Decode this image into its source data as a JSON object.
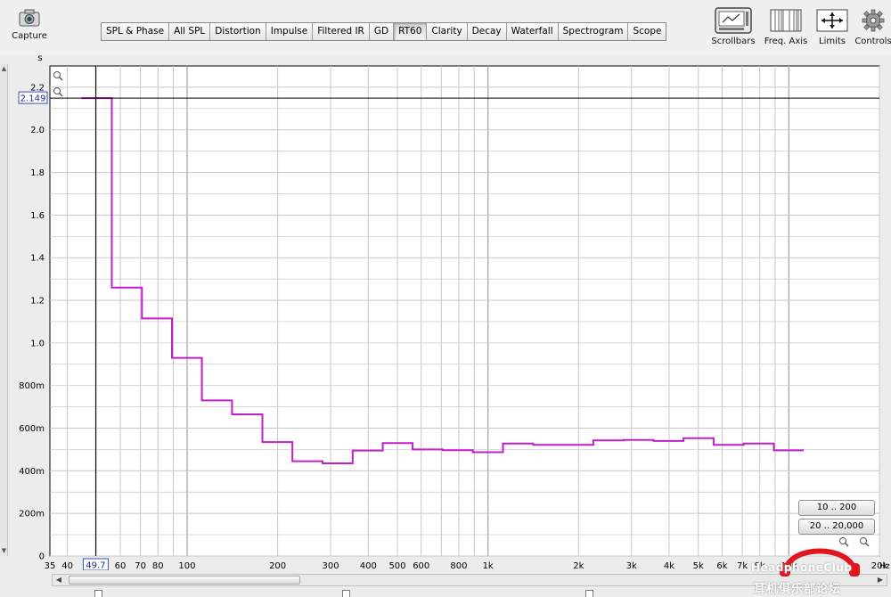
{
  "toolbar": {
    "capture_label": "Capture",
    "scrollbars_label": "Scrollbars",
    "freq_axis_label": "Freq. Axis",
    "limits_label": "Limits",
    "controls_label": "Controls"
  },
  "tabs": [
    {
      "label": "SPL & Phase",
      "active": false
    },
    {
      "label": "All SPL",
      "active": false
    },
    {
      "label": "Distortion",
      "active": false
    },
    {
      "label": "Impulse",
      "active": false
    },
    {
      "label": "Filtered IR",
      "active": false
    },
    {
      "label": "GD",
      "active": false
    },
    {
      "label": "RT60",
      "active": true
    },
    {
      "label": "Clarity",
      "active": false
    },
    {
      "label": "Decay",
      "active": false
    },
    {
      "label": "Waterfall",
      "active": false
    },
    {
      "label": "Spectrogram",
      "active": false
    },
    {
      "label": "Scope",
      "active": false
    }
  ],
  "cursor": {
    "y_value_label": "2.149",
    "x_value_label": "49.7",
    "x_value": 49.7,
    "y_value": 2.149
  },
  "range_buttons": {
    "low": "10 .. 200",
    "full": "20 .. 20,000"
  },
  "watermark": {
    "line1": "HeadphoneClub",
    "line2": "耳机俱乐部论坛"
  },
  "colors": {
    "trace": "#c020c8",
    "grid": "#c8c8c8",
    "grid_major": "#a8a8a8",
    "cursor": "#000000",
    "watermark_logo": "#e0161c"
  },
  "chart_data": {
    "type": "line",
    "title": "",
    "xlabel": "Hz",
    "ylabel": "s",
    "x_scale": "log",
    "xlim": [
      35,
      20000
    ],
    "ylim": [
      0,
      2.3
    ],
    "grid": true,
    "y_ticks": [
      {
        "value": 0,
        "label": "0"
      },
      {
        "value": 0.2,
        "label": "200m"
      },
      {
        "value": 0.4,
        "label": "400m"
      },
      {
        "value": 0.6,
        "label": "600m"
      },
      {
        "value": 0.8,
        "label": "800m"
      },
      {
        "value": 1.0,
        "label": "1.0"
      },
      {
        "value": 1.2,
        "label": "1.2"
      },
      {
        "value": 1.4,
        "label": "1.4"
      },
      {
        "value": 1.6,
        "label": "1.6"
      },
      {
        "value": 1.8,
        "label": "1.8"
      },
      {
        "value": 2.0,
        "label": "2.0"
      },
      {
        "value": 2.2,
        "label": "2.2"
      }
    ],
    "x_ticks": [
      {
        "value": 35,
        "label": "35"
      },
      {
        "value": 40,
        "label": "40"
      },
      {
        "value": 60,
        "label": "60"
      },
      {
        "value": 70,
        "label": "70"
      },
      {
        "value": 80,
        "label": "80"
      },
      {
        "value": 100,
        "label": "100"
      },
      {
        "value": 200,
        "label": "200"
      },
      {
        "value": 300,
        "label": "300"
      },
      {
        "value": 400,
        "label": "400"
      },
      {
        "value": 500,
        "label": "500"
      },
      {
        "value": 600,
        "label": "600"
      },
      {
        "value": 800,
        "label": "800"
      },
      {
        "value": 1000,
        "label": "1k"
      },
      {
        "value": 2000,
        "label": "2k"
      },
      {
        "value": 3000,
        "label": "3k"
      },
      {
        "value": 4000,
        "label": "4k"
      },
      {
        "value": 5000,
        "label": "5k"
      },
      {
        "value": 6000,
        "label": "6k"
      },
      {
        "value": 7000,
        "label": "7k"
      },
      {
        "value": 8000,
        "label": "8k"
      },
      {
        "value": 10000,
        "label": "10k"
      },
      {
        "value": 20000,
        "label": "20k"
      }
    ],
    "series": [
      {
        "bands": [
          {
            "f_lo": 44.6,
            "f_hi": 56.2,
            "rt60": 2.149
          },
          {
            "f_lo": 56.2,
            "f_hi": 70.8,
            "rt60": 1.26
          },
          {
            "f_lo": 70.8,
            "f_hi": 89.1,
            "rt60": 1.115
          },
          {
            "f_lo": 89.1,
            "f_hi": 112,
            "rt60": 0.93
          },
          {
            "f_lo": 112,
            "f_hi": 141,
            "rt60": 0.73
          },
          {
            "f_lo": 141,
            "f_hi": 178,
            "rt60": 0.665
          },
          {
            "f_lo": 178,
            "f_hi": 224,
            "rt60": 0.535
          },
          {
            "f_lo": 224,
            "f_hi": 282,
            "rt60": 0.445
          },
          {
            "f_lo": 282,
            "f_hi": 355,
            "rt60": 0.435
          },
          {
            "f_lo": 355,
            "f_hi": 447,
            "rt60": 0.495
          },
          {
            "f_lo": 447,
            "f_hi": 562,
            "rt60": 0.53
          },
          {
            "f_lo": 562,
            "f_hi": 708,
            "rt60": 0.5
          },
          {
            "f_lo": 708,
            "f_hi": 891,
            "rt60": 0.497
          },
          {
            "f_lo": 891,
            "f_hi": 1122,
            "rt60": 0.487
          },
          {
            "f_lo": 1122,
            "f_hi": 1413,
            "rt60": 0.528
          },
          {
            "f_lo": 1413,
            "f_hi": 1778,
            "rt60": 0.522
          },
          {
            "f_lo": 1778,
            "f_hi": 2239,
            "rt60": 0.522
          },
          {
            "f_lo": 2239,
            "f_hi": 2818,
            "rt60": 0.543
          },
          {
            "f_lo": 2818,
            "f_hi": 3548,
            "rt60": 0.545
          },
          {
            "f_lo": 3548,
            "f_hi": 4467,
            "rt60": 0.54
          },
          {
            "f_lo": 4467,
            "f_hi": 5623,
            "rt60": 0.553
          },
          {
            "f_lo": 5623,
            "f_hi": 7079,
            "rt60": 0.522
          },
          {
            "f_lo": 7079,
            "f_hi": 8913,
            "rt60": 0.528
          },
          {
            "f_lo": 8913,
            "f_hi": 11220,
            "rt60": 0.496
          }
        ]
      }
    ]
  }
}
